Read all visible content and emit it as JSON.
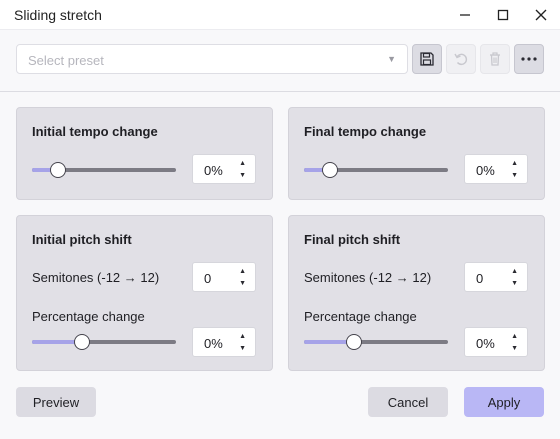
{
  "window": {
    "title": "Sliding stretch"
  },
  "toolbar": {
    "preset_placeholder": "Select preset",
    "save_icon": "floppy-disk-icon",
    "undo_icon": "undo-icon",
    "delete_icon": "trash-icon",
    "more_icon": "ellipsis-icon"
  },
  "panels": {
    "initial_tempo": {
      "title": "Initial tempo change",
      "value": "0%",
      "slider_level": 0.18
    },
    "final_tempo": {
      "title": "Final tempo change",
      "value": "0%",
      "slider_level": 0.18
    },
    "initial_pitch": {
      "title": "Initial pitch shift",
      "semitones_label": "Semitones (-12 → 12)",
      "semitones_value": "0",
      "percent_label": "Percentage change",
      "percent_value": "0%",
      "slider_level": 0.35
    },
    "final_pitch": {
      "title": "Final pitch shift",
      "semitones_label": "Semitones (-12 → 12)",
      "semitones_value": "0",
      "percent_label": "Percentage change",
      "percent_value": "0%",
      "slider_level": 0.35
    }
  },
  "buttons": {
    "preview": "Preview",
    "cancel": "Cancel",
    "apply": "Apply"
  },
  "colors": {
    "accent": "#b9b7f5",
    "panel": "#e1e0e6",
    "slider_fill": "#a6a3e8"
  }
}
